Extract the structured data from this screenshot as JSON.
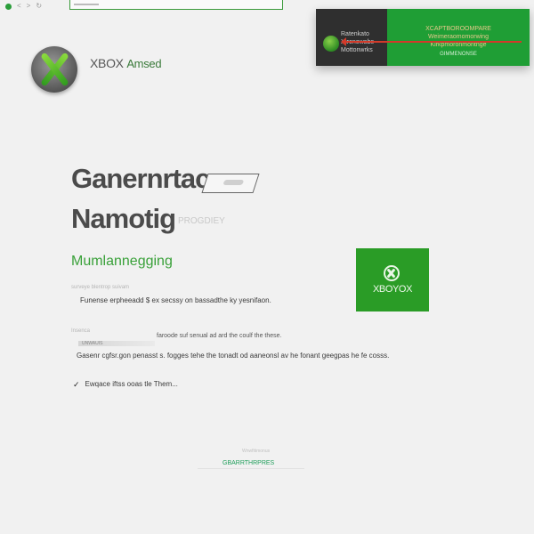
{
  "browser": {
    "nav_icons": [
      "<",
      ">",
      "↻"
    ]
  },
  "banner": {
    "left_text": "Ratenkato\nXtronowabs\nMottonwrks",
    "right_text": "XCAPTBOROOMPARE\nWeimeraomomorwing\nKirkpmoronmontnge",
    "right_sub": "GIMMENONSE"
  },
  "logo": {
    "brand": "XBOX",
    "suffix": "Amsed"
  },
  "headline": {
    "line1": "Ganernrtac",
    "line2": "Namotig",
    "line2_ghost": "PROGDIEY"
  },
  "subtitle": "Mumlannegging",
  "tile": {
    "label": "XBOYOX"
  },
  "content": {
    "faint_label_1": "surveye blentrop suivam",
    "line1": "Funense erpheeadd $ ex secssy on bassadthe ky yesnifaon.",
    "faint_label_2": "Insenca",
    "faint_line_2": "faroode suf senual ad ard the coulf the these.",
    "progress_label": "UNWAUIS",
    "line2": "Gasenr cgfsr.gon penasst s. fogges tehe the tonadt od aaneonsl av he fonant geegpas he fe cosss.",
    "check_text": "Ewqace iftss ooas tle Them..."
  },
  "footer": {
    "faint": "Wnwfitimonus",
    "link": "GBARRTHRPRES"
  },
  "colors": {
    "brand_green": "#2a9c26",
    "accent_green": "#3aa13a",
    "banner_dark": "#2f2f2f",
    "arrow_red": "#d13a2a"
  }
}
